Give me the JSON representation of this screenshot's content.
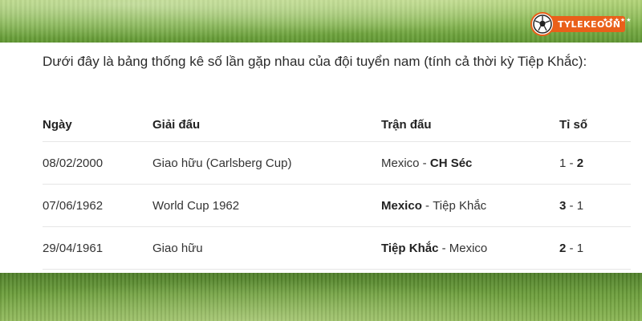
{
  "logo": {
    "text": "TYLEKEOON",
    "stars": "★★★★★"
  },
  "intro_text": "Dưới đây là bảng thống kê số lần gặp nhau của đội tuyển nam (tính cả thời kỳ Tiệp Khắc):",
  "table": {
    "headers": {
      "date": "Ngày",
      "competition": "Giải đấu",
      "match": "Trận đấu",
      "score": "Tỉ số"
    },
    "rows": [
      {
        "date": "08/02/2000",
        "competition": "Giao hữu (Carlsberg Cup)",
        "home": "Mexico",
        "sep": " - ",
        "away": "CH Séc",
        "winner": "away",
        "score_home": "1",
        "score_sep": " - ",
        "score_away": "2"
      },
      {
        "date": "07/06/1962",
        "competition": "World Cup 1962",
        "home": "Mexico",
        "sep": " - ",
        "away": "Tiệp Khắc",
        "winner": "home",
        "score_home": "3",
        "score_sep": " - ",
        "score_away": "1"
      },
      {
        "date": "29/04/1961",
        "competition": "Giao hữu",
        "home": "Tiệp Khắc",
        "sep": " - ",
        "away": "Mexico",
        "winner": "home",
        "score_home": "2",
        "score_sep": " - ",
        "score_away": "1"
      }
    ]
  },
  "colors": {
    "brand": "#e9601a",
    "grass": "#6d9f3c"
  }
}
